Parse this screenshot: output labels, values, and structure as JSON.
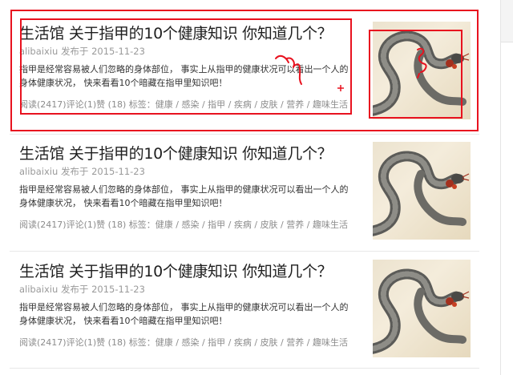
{
  "articles": [
    {
      "title": "生活馆 关于指甲的10个健康知识 你知道几个？",
      "author": "alibaixiu",
      "published_label": "发布于",
      "date": "2015-11-23",
      "summary": "指甲是经常容易被人们忽略的身体部位， 事实上从指甲的健康状况可以看出一个人的身体健康状况， 快来看看10个暗藏在指甲里知识吧！",
      "reads": "阅读(2417)",
      "comments": "评论(1)",
      "likes": "赞 (18)",
      "tags_label": "标签：",
      "tags": [
        "健康",
        "感染",
        "指甲",
        "疾病",
        "皮肤",
        "营养",
        "趣味生活"
      ],
      "thumb_icon": "snake-image"
    },
    {
      "title": "生活馆 关于指甲的10个健康知识 你知道几个？",
      "author": "alibaixiu",
      "published_label": "发布于",
      "date": "2015-11-23",
      "summary": "指甲是经常容易被人们忽略的身体部位， 事实上从指甲的健康状况可以看出一个人的身体健康状况， 快来看看10个暗藏在指甲里知识吧！",
      "reads": "阅读(2417)",
      "comments": "评论(1)",
      "likes": "赞 (18)",
      "tags_label": "标签：",
      "tags": [
        "健康",
        "感染",
        "指甲",
        "疾病",
        "皮肤",
        "营养",
        "趣味生活"
      ],
      "thumb_icon": "snake-image"
    },
    {
      "title": "生活馆 关于指甲的10个健康知识 你知道几个？",
      "author": "alibaixiu",
      "published_label": "发布于",
      "date": "2015-11-23",
      "summary": "指甲是经常容易被人们忽略的身体部位， 事实上从指甲的健康状况可以看出一个人的身体健康状况， 快来看看10个暗藏在指甲里知识吧！",
      "reads": "阅读(2417)",
      "comments": "评论(1)",
      "likes": "赞 (18)",
      "tags_label": "标签：",
      "tags": [
        "健康",
        "感染",
        "指甲",
        "疾病",
        "皮肤",
        "营养",
        "趣味生活"
      ],
      "thumb_icon": "snake-image"
    }
  ],
  "annotation": {
    "color": "#e8121f"
  }
}
